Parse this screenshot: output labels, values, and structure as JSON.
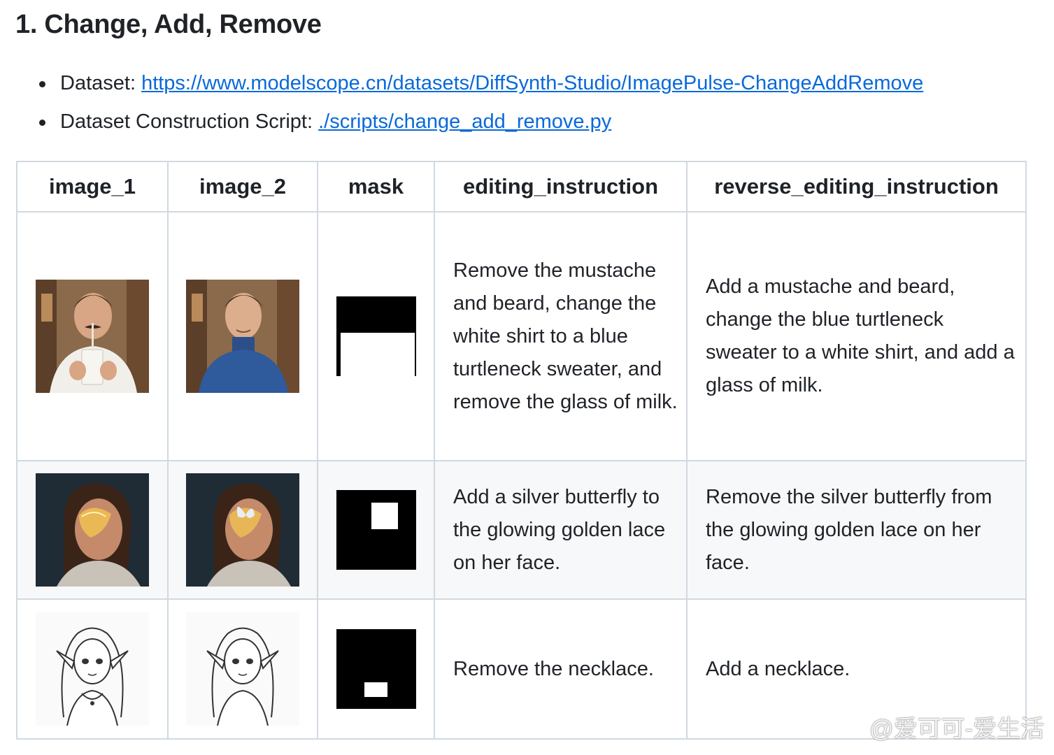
{
  "heading": "1. Change, Add, Remove",
  "bullets": [
    {
      "label": "Dataset: ",
      "link": "https://www.modelscope.cn/datasets/DiffSynth-Studio/ImagePulse-ChangeAddRemove"
    },
    {
      "label": "Dataset Construction Script: ",
      "link": "./scripts/change_add_remove.py"
    }
  ],
  "table": {
    "headers": [
      "image_1",
      "image_2",
      "mask",
      "editing_instruction",
      "reverse_editing_instruction"
    ],
    "rows": [
      {
        "editing_instruction": "Remove the mustache and beard, change the white shirt to a blue turtleneck sweater, and remove the glass of milk.",
        "reverse_editing_instruction": "Add a mustache and beard, change the blue turtleneck sweater to a white shirt, and add a glass of milk."
      },
      {
        "editing_instruction": "Add a silver butterfly to the glowing golden lace on her face.",
        "reverse_editing_instruction": "Remove the silver butterfly from the glowing golden lace on her face."
      },
      {
        "editing_instruction": "Remove the necklace.",
        "reverse_editing_instruction": "Add a necklace."
      }
    ]
  },
  "watermark": "@爱可可-爱生活"
}
